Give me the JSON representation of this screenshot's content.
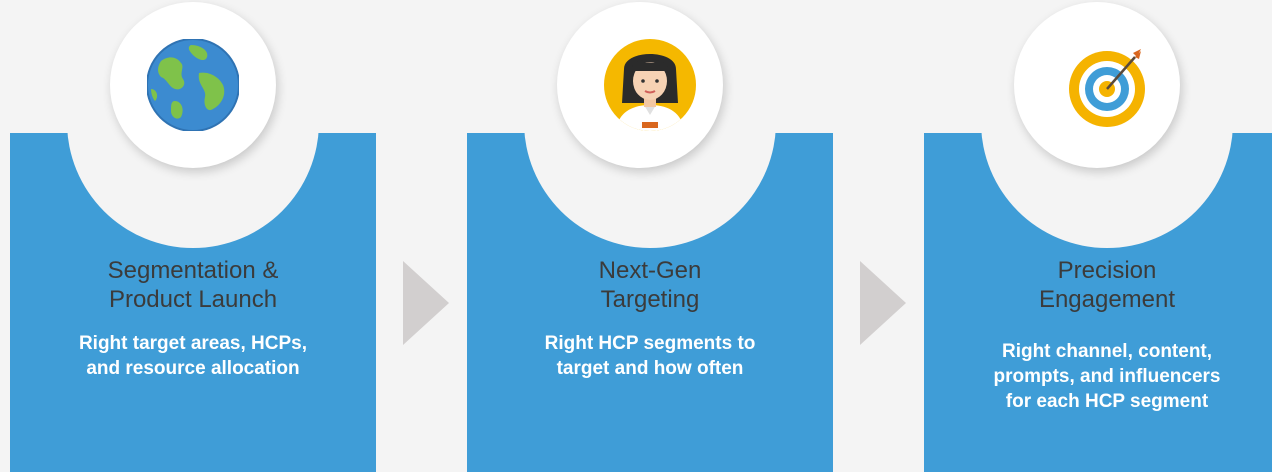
{
  "steps": [
    {
      "icon": "globe-icon",
      "title_line1": "Segmentation &",
      "title_line2": "Product Launch",
      "desc_line1": "Right target areas, HCPs,",
      "desc_line2": "and resource allocation",
      "desc_line3": ""
    },
    {
      "icon": "doctor-avatar-icon",
      "title_line1": "Next-Gen",
      "title_line2": "Targeting",
      "desc_line1": "Right HCP segments to",
      "desc_line2": "target and how often",
      "desc_line3": ""
    },
    {
      "icon": "target-icon",
      "title_line1": "Precision",
      "title_line2": "Engagement",
      "desc_line1": "Right channel, content,",
      "desc_line2": "prompts, and influencers",
      "desc_line3": "for each HCP segment"
    }
  ],
  "colors": {
    "card": "#3f9dd7",
    "background": "#f4f4f4",
    "arrow": "#d2cfcf",
    "title_text": "#3b3b3b",
    "desc_text": "#ffffff"
  }
}
